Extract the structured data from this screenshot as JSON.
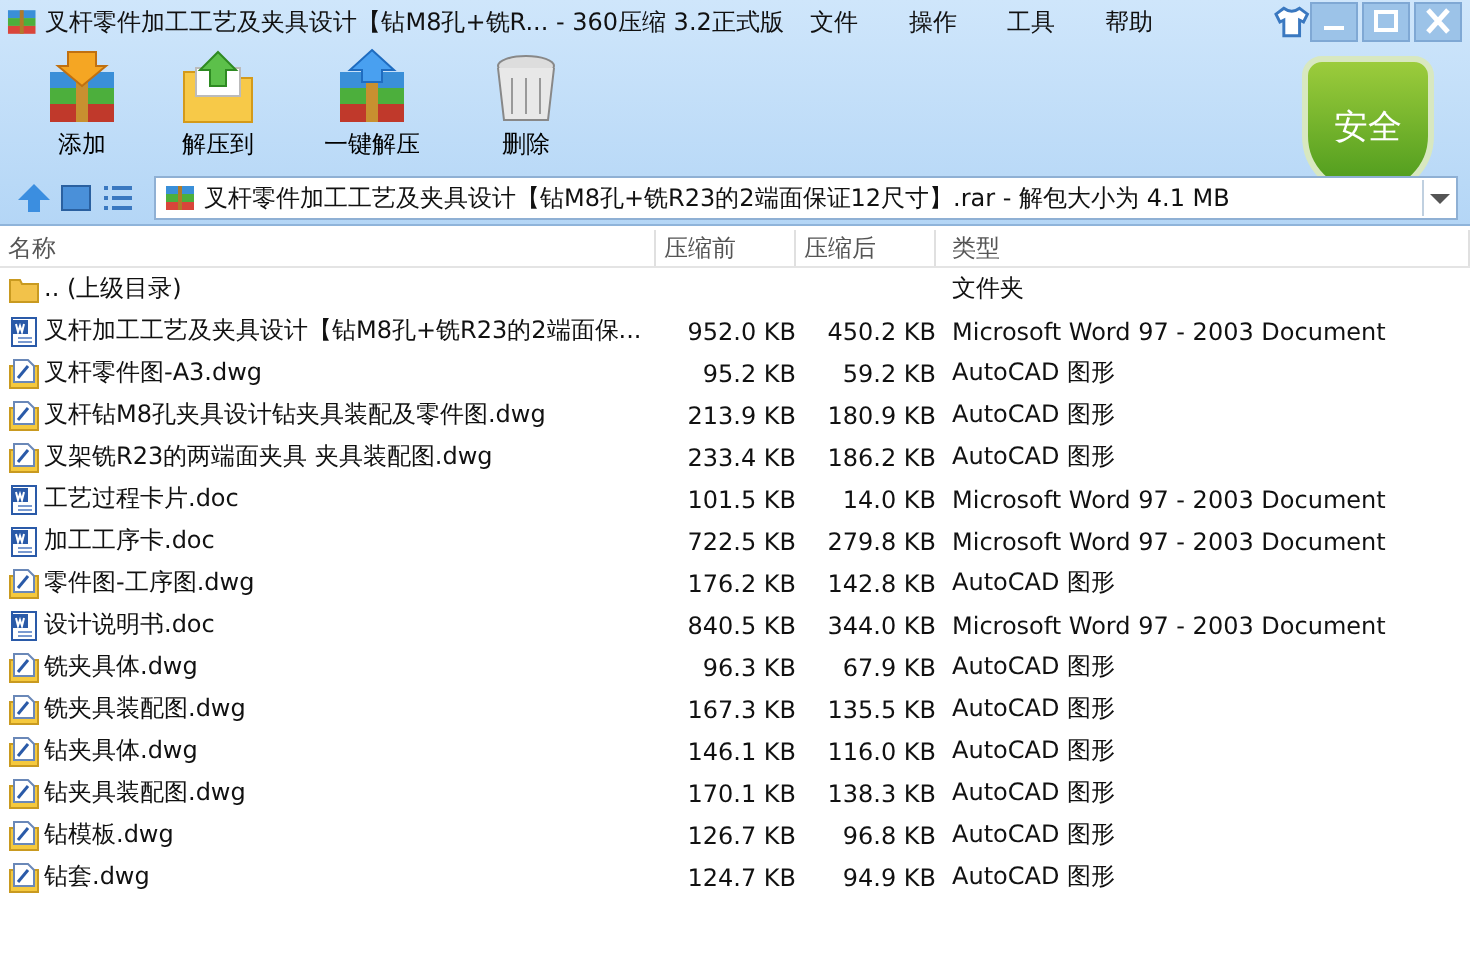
{
  "window": {
    "title": "叉杆零件加工工艺及夹具设计【钻M8孔+铣R... - 360压缩 3.2正式版"
  },
  "menu": [
    "文件",
    "操作",
    "工具",
    "帮助"
  ],
  "toolbar": [
    {
      "label": "添加",
      "kind": "add"
    },
    {
      "label": "解压到",
      "kind": "extract"
    },
    {
      "label": "一键解压",
      "kind": "oneclick"
    },
    {
      "label": "删除",
      "kind": "delete"
    }
  ],
  "security_badge": "安全",
  "address": {
    "value": "叉杆零件加工工艺及夹具设计【钻M8孔+铣R23的2端面保证12尺寸】.rar - 解包大小为 4.1 MB"
  },
  "table": {
    "columns": [
      "名称",
      "压缩前",
      "压缩后",
      "类型"
    ],
    "rows": [
      {
        "kind": "folder",
        "name": ".. (上级目录)",
        "before": "",
        "after": "",
        "type": "文件夹"
      },
      {
        "kind": "doc",
        "name": "叉杆加工工艺及夹具设计【钻M8孔+铣R23的2端面保...",
        "before": "952.0 KB",
        "after": "450.2 KB",
        "type": "Microsoft Word 97 - 2003 Document"
      },
      {
        "kind": "dwg",
        "name": "叉杆零件图-A3.dwg",
        "before": "95.2 KB",
        "after": "59.2 KB",
        "type": "AutoCAD 图形"
      },
      {
        "kind": "dwg",
        "name": "叉杆钻M8孔夹具设计钻夹具装配及零件图.dwg",
        "before": "213.9 KB",
        "after": "180.9 KB",
        "type": "AutoCAD 图形"
      },
      {
        "kind": "dwg",
        "name": "叉架铣R23的两端面夹具 夹具装配图.dwg",
        "before": "233.4 KB",
        "after": "186.2 KB",
        "type": "AutoCAD 图形"
      },
      {
        "kind": "doc",
        "name": "工艺过程卡片.doc",
        "before": "101.5 KB",
        "after": "14.0 KB",
        "type": "Microsoft Word 97 - 2003 Document"
      },
      {
        "kind": "doc",
        "name": "加工工序卡.doc",
        "before": "722.5 KB",
        "after": "279.8 KB",
        "type": "Microsoft Word 97 - 2003 Document"
      },
      {
        "kind": "dwg",
        "name": "零件图-工序图.dwg",
        "before": "176.2 KB",
        "after": "142.8 KB",
        "type": "AutoCAD 图形"
      },
      {
        "kind": "doc",
        "name": "设计说明书.doc",
        "before": "840.5 KB",
        "after": "344.0 KB",
        "type": "Microsoft Word 97 - 2003 Document"
      },
      {
        "kind": "dwg",
        "name": "铣夹具体.dwg",
        "before": "96.3 KB",
        "after": "67.9 KB",
        "type": "AutoCAD 图形"
      },
      {
        "kind": "dwg",
        "name": "铣夹具装配图.dwg",
        "before": "167.3 KB",
        "after": "135.5 KB",
        "type": "AutoCAD 图形"
      },
      {
        "kind": "dwg",
        "name": "钻夹具体.dwg",
        "before": "146.1 KB",
        "after": "116.0 KB",
        "type": "AutoCAD 图形"
      },
      {
        "kind": "dwg",
        "name": "钻夹具装配图.dwg",
        "before": "170.1 KB",
        "after": "138.3 KB",
        "type": "AutoCAD 图形"
      },
      {
        "kind": "dwg",
        "name": "钻模板.dwg",
        "before": "126.7 KB",
        "after": "96.8 KB",
        "type": "AutoCAD 图形"
      },
      {
        "kind": "dwg",
        "name": "钻套.dwg",
        "before": "124.7 KB",
        "after": "94.9 KB",
        "type": "AutoCAD 图形"
      }
    ]
  }
}
